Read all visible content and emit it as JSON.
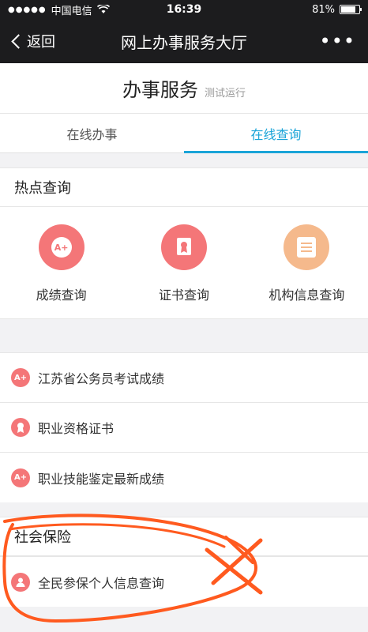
{
  "status_bar": {
    "carrier": "中国电信",
    "time": "16:39",
    "battery": "81%",
    "battery_level": 0.81
  },
  "nav": {
    "back_label": "返回",
    "title": "网上办事服务大厅",
    "more_label": "•••"
  },
  "page": {
    "title": "办事服务",
    "subtitle": "测试运行"
  },
  "tabs": [
    {
      "label": "在线办事",
      "active": false
    },
    {
      "label": "在线查询",
      "active": true
    }
  ],
  "hot_section": {
    "title": "热点查询",
    "items": [
      {
        "label": "成绩查询",
        "icon": "grade-icon",
        "glyph": "A+",
        "color": "#f47678"
      },
      {
        "label": "证书查询",
        "icon": "certificate-icon",
        "color": "#f47678"
      },
      {
        "label": "机构信息查询",
        "icon": "institution-icon",
        "color": "#f5b98c"
      }
    ]
  },
  "list": {
    "items": [
      {
        "label": "江苏省公务员考试成绩",
        "icon": "grade-icon",
        "glyph": "A+"
      },
      {
        "label": "职业资格证书",
        "icon": "certificate-icon"
      },
      {
        "label": "职业技能鉴定最新成绩",
        "icon": "grade-icon",
        "glyph": "A+"
      }
    ]
  },
  "social_section": {
    "title": "社会保险",
    "items": [
      {
        "label": "全民参保个人信息查询",
        "icon": "person-icon"
      }
    ]
  },
  "colors": {
    "accent": "#1aa4d8",
    "icon_red": "#f47678",
    "icon_orange": "#f5b98c",
    "annotation": "#ff5a1f"
  }
}
